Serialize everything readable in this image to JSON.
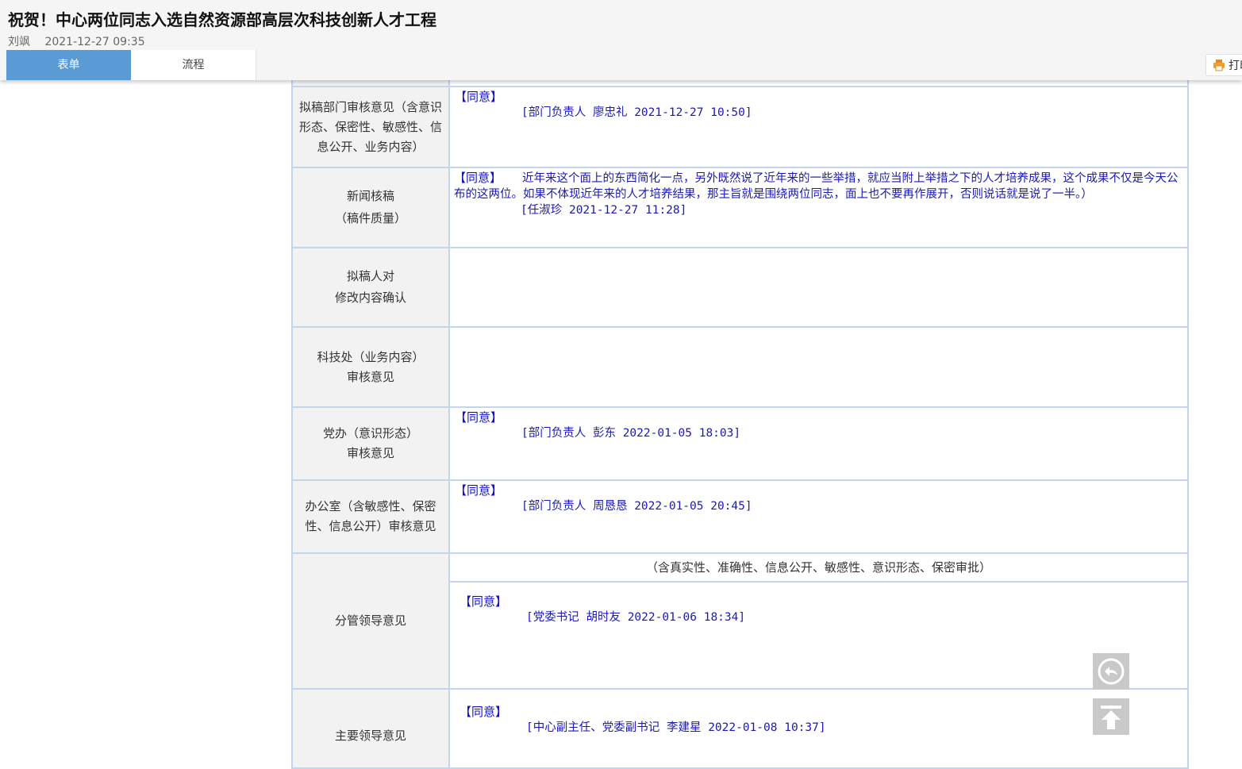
{
  "header": {
    "title": "祝贺！中心两位同志入选自然资源部高层次科技创新人才工程",
    "author": "刘飒",
    "date": "2021-12-27 09:35",
    "tabs": [
      "表单",
      "流程"
    ],
    "print_label": "打印"
  },
  "rows": [
    {
      "label": "拟稿部门审核意见（含意识形态、保密性、敏感性、信息公开、业务内容）",
      "opinion": "【同意】",
      "signature": "[部门负责人 廖忠礼 2021-12-27 10:50]"
    },
    {
      "label_lines": [
        "新闻核稿",
        "（稿件质量）"
      ],
      "opinion": "【同意】",
      "comment": "近年来这个面上的东西简化一点，另外既然说了近年来的一些举措，就应当附上举措之下的人才培养成果，这个成果不仅是今天公布的这两位。如果不体现近年来的人才培养结果，那主旨就是围绕两位同志，面上也不要再作展开，否则说话就是说了一半。）",
      "signature": "[任淑珍 2021-12-27 11:28]"
    },
    {
      "label_lines": [
        "拟稿人对",
        "修改内容确认"
      ]
    },
    {
      "label_lines": [
        "科技处（业务内容）",
        "审核意见"
      ]
    },
    {
      "label_lines": [
        "党办（意识形态）",
        "审核意见"
      ],
      "opinion": "【同意】",
      "signature": "[部门负责人 彭东 2022-01-05 18:03]"
    },
    {
      "label": "办公室（含敏感性、保密性、信息公开）审核意见",
      "opinion": "【同意】",
      "signature": "[部门负责人 周恳恳 2022-01-05 20:45]"
    },
    {
      "label": "分管领导意见",
      "note": "（含真实性、准确性、信息公开、敏感性、意识形态、保密审批）",
      "opinion": "【同意】",
      "signature": "[党委书记 胡时友 2022-01-06 18:34]"
    },
    {
      "label": "主要领导意见",
      "opinion": "【同意】",
      "signature": "[中心副主任、党委副书记 李建星 2022-01-08 10:37]"
    }
  ],
  "floating_buttons": [
    {
      "name": "back-icon"
    },
    {
      "name": "back-to-top-icon"
    }
  ],
  "colors": {
    "tab_active": "#5b9bd5",
    "opinion_text": "#1010c8",
    "table_border": "#c5d6ec",
    "label_bg": "#f2f2f2"
  }
}
